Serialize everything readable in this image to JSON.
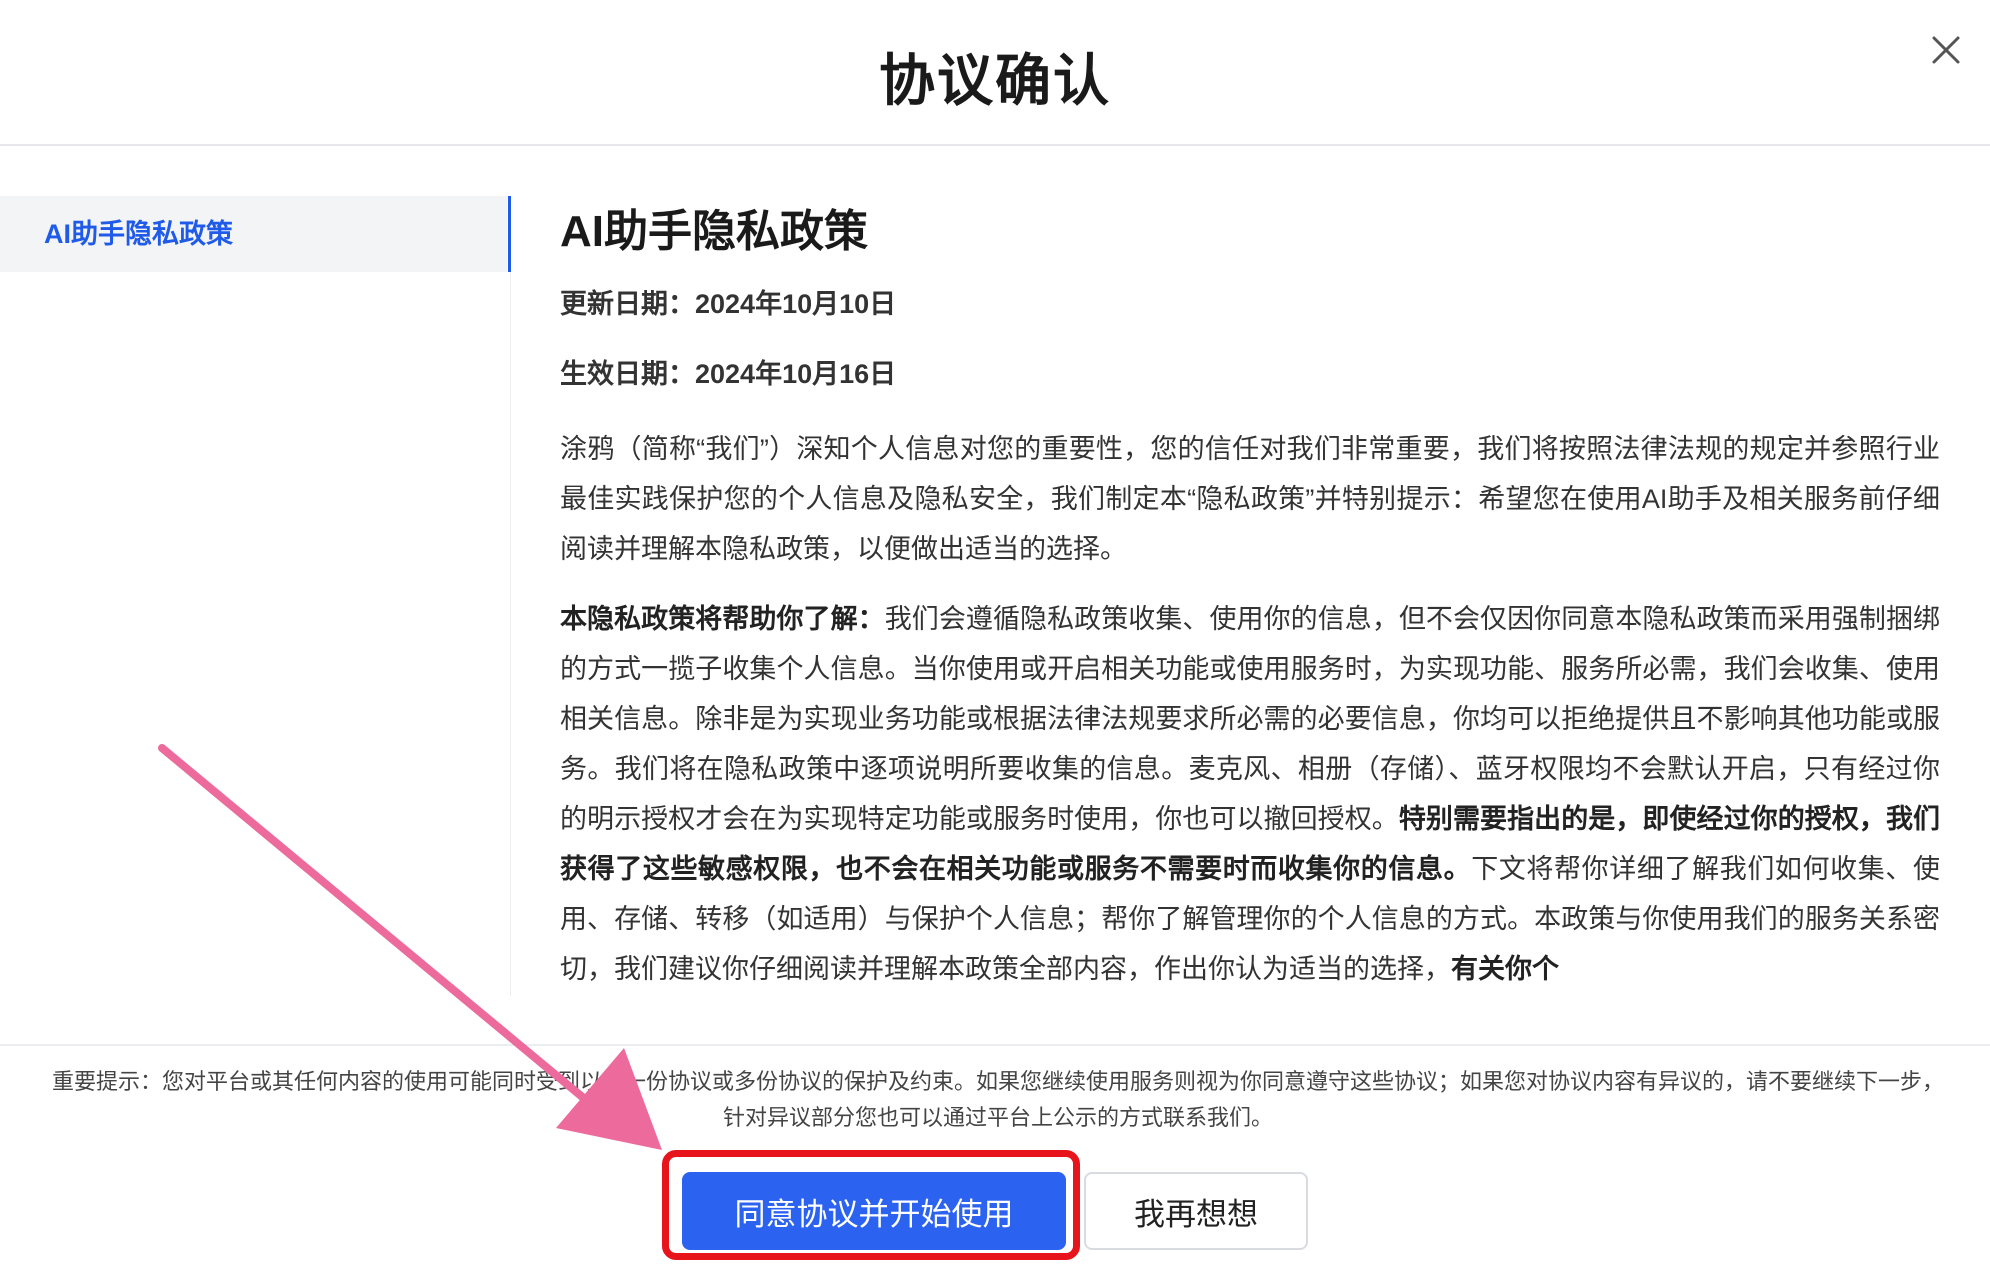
{
  "dialog": {
    "title": "协议确认"
  },
  "sidebar": {
    "items": [
      {
        "label": "AI助手隐私政策",
        "active": true
      }
    ]
  },
  "document": {
    "title": "AI助手隐私政策",
    "update_date": "更新日期：2024年10月10日",
    "effective_date": "生效日期：2024年10月16日",
    "para1": "涂鸦（简称“我们”）深知个人信息对您的重要性，您的信任对我们非常重要，我们将按照法律法规的规定并参照行业最佳实践保护您的个人信息及隐私安全，我们制定本“隐私政策”并特别提示：希望您在使用AI助手及相关服务前仔细阅读并理解本隐私政策，以便做出适当的选择。",
    "para2_lead": "本隐私政策将帮助你了解：",
    "para2_a": "我们会遵循隐私政策收集、使用你的信息，但不会仅因你同意本隐私政策而采用强制捆绑的方式一揽子收集个人信息。当你使用或开启相关功能或使用服务时，为实现功能、服务所必需，我们会收集、使用相关信息。除非是为实现业务功能或根据法律法规要求所必需的必要信息，你均可以拒绝提供且不影响其他功能或服务。我们将在隐私政策中逐项说明所要收集的信息。麦克风、相册（存储）、蓝牙权限均不会默认开启，只有经过你的明示授权才会在为实现特定功能或服务时使用，你也可以撤回授权。",
    "para2_b": "特别需要指出的是，即使经过你的授权，我们获得了这些敏感权限，也不会在相关功能或服务不需要时而收集你的信息。",
    "para2_c": "下文将帮你详细了解我们如何收集、使用、存储、转移（如适用）与保护个人信息；帮你了解管理你的个人信息的方式。本政策与你使用我们的服务关系密切，我们建议你仔细阅读并理解本政策全部内容，作出你认为适当的选择，",
    "para2_d": "有关你个"
  },
  "footer": {
    "notice": "重要提示：您对平台或其任何内容的使用可能同时受到以上一份协议或多份协议的保护及约束。如果您继续使用服务则视为你同意遵守这些协议；如果您对协议内容有异议的，请不要继续下一步，针对异议部分您也可以通过平台上公示的方式联系我们。",
    "agree_label": "同意协议并开始使用",
    "decline_label": "我再想想"
  },
  "colors": {
    "accent": "#2b62f0",
    "sidebar_active": "#1f5ae8",
    "highlight": "#e8141c",
    "arrow": "#ec6a9c"
  }
}
